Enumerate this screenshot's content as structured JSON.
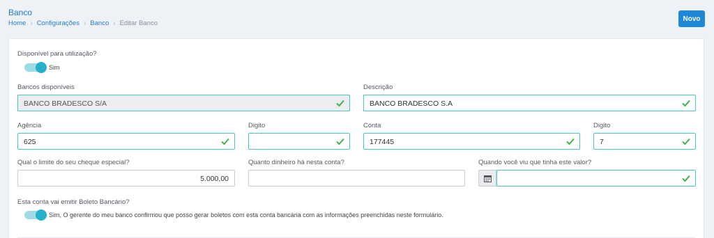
{
  "header": {
    "title": "Banco",
    "breadcrumb": [
      "Home",
      "Configurações",
      "Banco",
      "Editar Banco"
    ],
    "new_button": "Novo"
  },
  "form": {
    "availability": {
      "label": "Disponível para utilização?",
      "toggle_text": "Sim",
      "on": true
    },
    "banks_available": {
      "label": "Bancos disponíveis",
      "value": "BANCO BRADESCO S/A"
    },
    "description": {
      "label": "Descrição",
      "value": "BANCO BRADESCO S.A"
    },
    "agency": {
      "label": "Agência",
      "value": "625"
    },
    "agency_digit": {
      "label": "Digito",
      "value": ""
    },
    "account": {
      "label": "Conta",
      "value": "177445"
    },
    "account_digit": {
      "label": "Digito",
      "value": "7"
    },
    "overdraft_limit": {
      "label": "Qual o limite do seu cheque especial?",
      "value": "5.000,00"
    },
    "account_balance": {
      "label": "Quanto dinheiro há nesta conta?",
      "value": ""
    },
    "value_date": {
      "label": "Quando você viu que tinha este valor?",
      "value": ""
    },
    "boleto": {
      "label": "Esta conta vai emitir Boleto Bancário?",
      "toggle_text": "Sim, O gerente do meu banco confirmou que posso gerar boletos com esta conta bancária com as informações preenchidas neste formulário.",
      "on": true
    }
  },
  "colors": {
    "primary": "#1e88d8",
    "valid_border": "#48c6c1",
    "check": "#44b24a",
    "toggle": "#24b1cc"
  }
}
